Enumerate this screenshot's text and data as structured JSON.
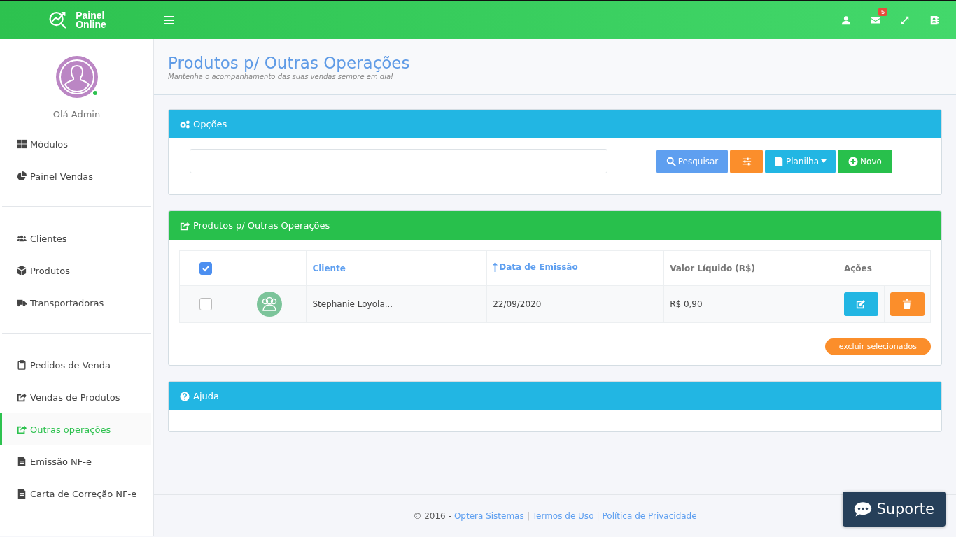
{
  "topbar": {
    "brand": [
      "Painel",
      "Online"
    ],
    "mail_badge": "5"
  },
  "sidebar": {
    "greeting": "Olá Admin",
    "online": true,
    "groups": [
      [
        {
          "label": "Módulos",
          "selected": false
        },
        {
          "label": "Painel Vendas",
          "selected": false
        }
      ],
      [
        {
          "label": "Clientes",
          "selected": false
        },
        {
          "label": "Produtos",
          "selected": false
        },
        {
          "label": "Transportadoras",
          "selected": false
        }
      ],
      [
        {
          "label": "Pedidos de Venda",
          "selected": false
        },
        {
          "label": "Vendas de Produtos",
          "selected": false
        },
        {
          "label": "Outras operações",
          "selected": true
        },
        {
          "label": "Emissão NF-e",
          "selected": false
        },
        {
          "label": "Carta de Correção NF-e",
          "selected": false
        }
      ]
    ]
  },
  "page": {
    "title": "Produtos p/ Outras Operações",
    "subtitle": "Mantenha o acompanhamento das suas vendas sempre em dia!"
  },
  "options_panel": {
    "title": "Opções",
    "buttons": [
      {
        "kind": "search",
        "label": "Pesquisar"
      },
      {
        "kind": "filter"
      },
      {
        "kind": "sheet",
        "label": "Planilha"
      },
      {
        "kind": "new",
        "label": "Novo"
      }
    ]
  },
  "list_panel": {
    "title": "Produtos p/ Outras Operações",
    "select_all_checked": true,
    "columns": [
      {
        "label": "Cliente",
        "sortable": true,
        "sorted": false
      },
      {
        "label": "Data de Emissão",
        "sortable": true,
        "sorted": true
      },
      {
        "label": "Valor Líquido (R$)",
        "sortable": false,
        "sorted": false
      },
      {
        "label": "Ações",
        "sortable": false,
        "sorted": false
      }
    ],
    "rows": [
      {
        "checked": false,
        "client": "Stephanie Loyola...",
        "date": "22/09/2020",
        "value": "R$ 0,90"
      }
    ],
    "delete_selected": "excluir selecionados"
  },
  "help_panel": {
    "title": "Ajuda"
  },
  "footer": {
    "prefix": "© 2016 -",
    "links": [
      "Optera Sistemas",
      "Termos de Uso",
      "Política de Privacidade"
    ],
    "separator": "|"
  },
  "support_button": "Suporte"
}
